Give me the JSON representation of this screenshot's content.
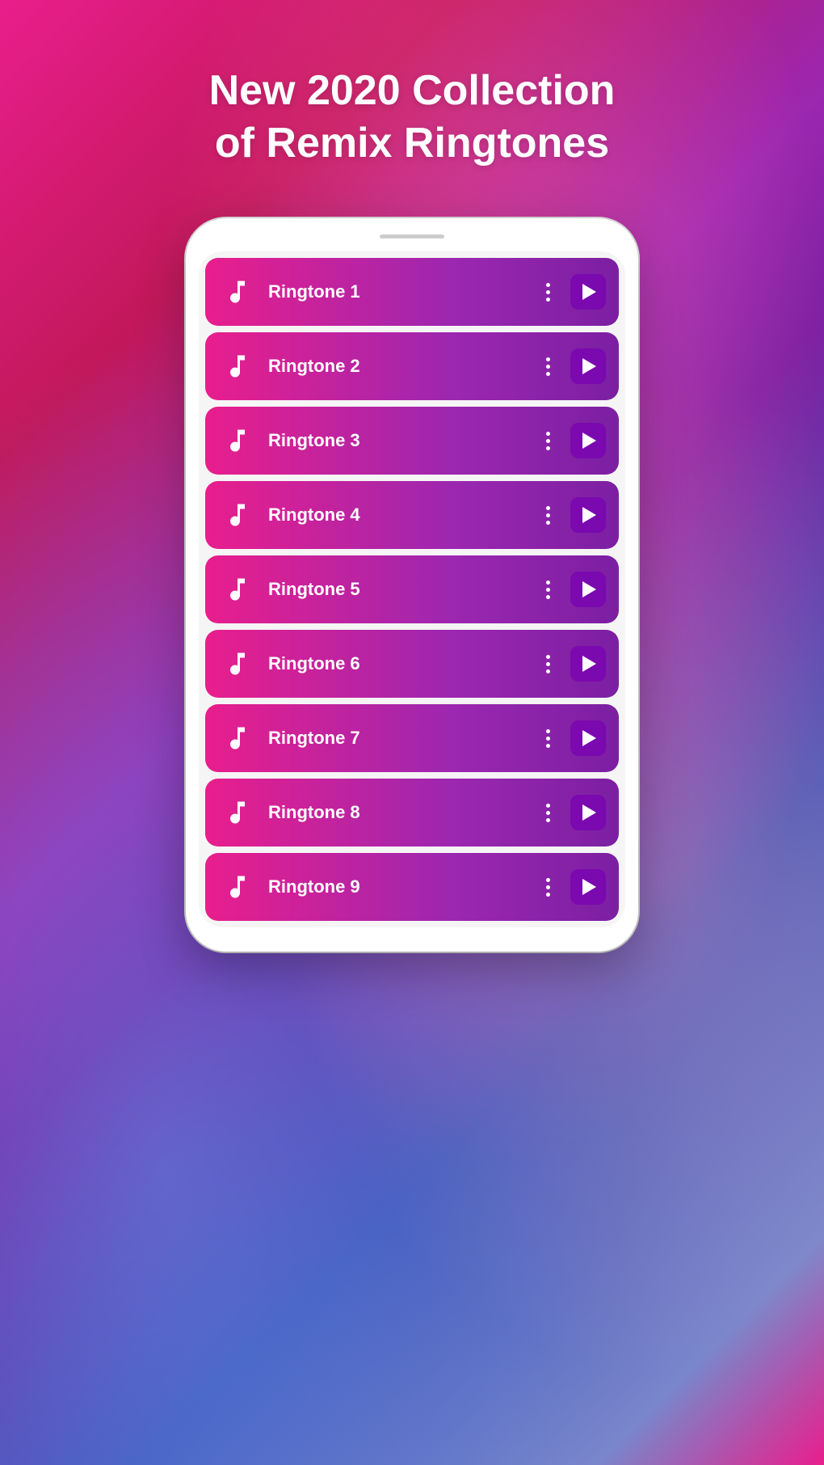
{
  "header": {
    "title_line1": "New 2020 Collection",
    "title_line2": "of Remix Ringtones"
  },
  "ringtones": [
    {
      "id": 1,
      "name": "Ringtone 1"
    },
    {
      "id": 2,
      "name": "Ringtone 2"
    },
    {
      "id": 3,
      "name": "Ringtone 3"
    },
    {
      "id": 4,
      "name": "Ringtone 4"
    },
    {
      "id": 5,
      "name": "Ringtone 5"
    },
    {
      "id": 6,
      "name": "Ringtone 6"
    },
    {
      "id": 7,
      "name": "Ringtone 7"
    },
    {
      "id": 8,
      "name": "Ringtone 8"
    },
    {
      "id": 9,
      "name": "Ringtone 9"
    }
  ]
}
